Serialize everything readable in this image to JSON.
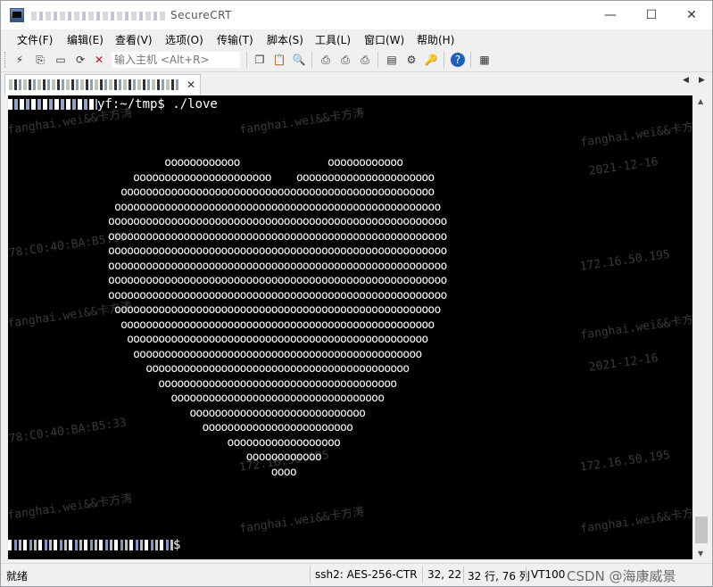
{
  "window": {
    "title": "SecureCRT",
    "minimize_glyph": "—",
    "maximize_glyph": "☐",
    "close_glyph": "✕"
  },
  "menu": [
    "文件(F)",
    "编辑(E)",
    "查看(V)",
    "选项(O)",
    "传输(T)",
    "脚本(S)",
    "工具(L)",
    "窗口(W)",
    "帮助(H)"
  ],
  "toolbar": {
    "host_placeholder": "输入主机 <Alt+R>",
    "icons": [
      "connect-icon",
      "quick-connect-icon",
      "connect-tab-icon",
      "reconnect-icon",
      "disconnect-icon",
      "copy-icon",
      "paste-icon",
      "find-icon",
      "print-icon",
      "print-selection-icon",
      "print-setup-icon",
      "session-options-icon",
      "global-options-icon",
      "keymap-icon",
      "help-icon",
      "sftp-icon"
    ]
  },
  "tab": {
    "label": "172.16.50.195 (hostname)",
    "close_glyph": "✕",
    "nav_left": "◀",
    "nav_right": "▶"
  },
  "terminal": {
    "command_line": "yf:~/tmp$ ./love",
    "final_prompt_suffix": "$",
    "heart_lines": [
      "           oooooooooooo              oooooooooooo",
      "      oooooooooooooooooooooo    oooooooooooooooooooooo",
      "    oooooooooooooooooooooooooooooooooooooooooooooooooo",
      "   oooooooooooooooooooooooooooooooooooooooooooooooooooo",
      "  oooooooooooooooooooooooooooooooooooooooooooooooooooooo",
      "  oooooooooooooooooooooooooooooooooooooooooooooooooooooo",
      "  oooooooooooooooooooooooooooooooooooooooooooooooooooooo",
      "  oooooooooooooooooooooooooooooooooooooooooooooooooooooo",
      "  oooooooooooooooooooooooooooooooooooooooooooooooooooooo",
      "  oooooooooooooooooooooooooooooooooooooooooooooooooooooo",
      "   oooooooooooooooooooooooooooooooooooooooooooooooooooo",
      "    oooooooooooooooooooooooooooooooooooooooooooooooooo",
      "     oooooooooooooooooooooooooooooooooooooooooooooooo",
      "      oooooooooooooooooooooooooooooooooooooooooooooo",
      "        oooooooooooooooooooooooooooooooooooooooooo",
      "          oooooooooooooooooooooooooooooooooooooo",
      "            oooooooooooooooooooooooooooooooooo",
      "               oooooooooooooooooooooooooooo",
      "                 oooooooooooooooooooooooo",
      "                     oooooooooooooooooo",
      "                        oooooooooooo",
      "                            oooo"
    ]
  },
  "watermarks": [
    "fanghai.wei&&卡方涛",
    "2021-12-16",
    "78:C0:40:BA:B5:33",
    "172.16.50.195"
  ],
  "status": {
    "ready": "就绪",
    "encryption": "ssh2: AES-256-CTR",
    "position": "32, 22",
    "rows_cols": "32 行, 76 列",
    "terminal_type": "VT100",
    "credit": "CSDN @海康威景"
  }
}
